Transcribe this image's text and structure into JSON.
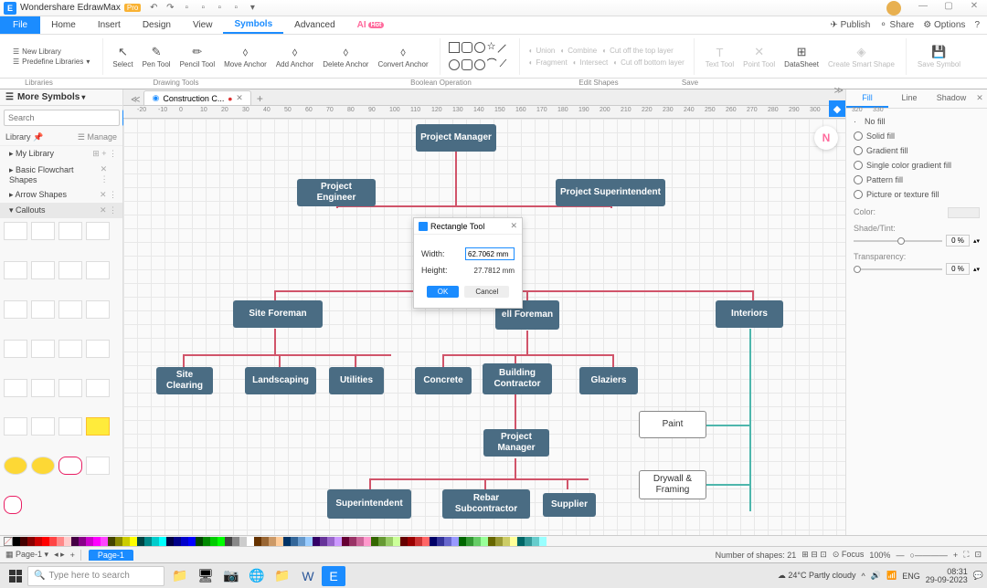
{
  "app": {
    "name": "Wondershare EdrawMax",
    "badge": "Pro"
  },
  "window_controls": {
    "min": "—",
    "max": "▢",
    "close": "✕"
  },
  "menu": {
    "file": "File",
    "home": "Home",
    "insert": "Insert",
    "design": "Design",
    "view": "View",
    "symbols": "Symbols",
    "advanced": "Advanced",
    "ai": "AI",
    "hot": "Hot",
    "publish": "✈ Publish",
    "share": "⚬ Share",
    "options": "⚙ Options"
  },
  "ribbon": {
    "new_library": "New Library",
    "predefine": "Predefine Libraries",
    "libraries": "Libraries",
    "select": "Select",
    "pen": "Pen Tool",
    "pencil": "Pencil Tool",
    "move_anchor": "Move Anchor",
    "add_anchor": "Add Anchor",
    "delete_anchor": "Delete Anchor",
    "convert_anchor": "Convert Anchor",
    "drawing": "Drawing Tools",
    "union": "Union",
    "combine": "Combine",
    "cut_top": "Cut off the top layer",
    "fragment": "Fragment",
    "intersect": "Intersect",
    "cut_bottom": "Cut off bottom layer",
    "boolean": "Boolean Operation",
    "text_tool": "Text Tool",
    "point_tool": "Point Tool",
    "datasheet": "DataSheet",
    "create_smart": "Create Smart Shape",
    "save_symbol": "Save Symbol",
    "edit": "Edit Shapes",
    "save": "Save"
  },
  "sidebar": {
    "more": "More Symbols",
    "search": "Search",
    "search_btn": "Search",
    "library": "Library",
    "manage": "Manage",
    "items": [
      "My Library",
      "Basic Flowchart Shapes",
      "Arrow Shapes",
      "Callouts"
    ]
  },
  "doc": {
    "tab": "Construction C...",
    "add": "+"
  },
  "ruler_marks": [
    -20,
    -10,
    0,
    10,
    20,
    30,
    40,
    50,
    60,
    70,
    80,
    90,
    100,
    110,
    120,
    130,
    140,
    150,
    160,
    170,
    180,
    190,
    200,
    210,
    220,
    230,
    240,
    250,
    260,
    270,
    280,
    290,
    300,
    310,
    320,
    330
  ],
  "nodes": {
    "pm": "Project Manager",
    "pe": "Project Engineer",
    "ps": "Project Superintendent",
    "sf": "Site Foreman",
    "shell": "ell Foreman",
    "interiors": "Interiors",
    "sc": "Site Clearing",
    "land": "Landscaping",
    "util": "Utilities",
    "conc": "Concrete",
    "bc": "Building Contractor",
    "glaz": "Glaziers",
    "pm2": "Project Manager",
    "super": "Superintendent",
    "rebar": "Rebar Subcontractor",
    "supplier": "Supplier",
    "paint": "Paint",
    "drywall": "Drywall & Framing"
  },
  "dialog": {
    "title": "Rectangle Tool",
    "width_label": "Width:",
    "width": "62.7062 mm",
    "height_label": "Height:",
    "height": "27.7812 mm",
    "ok": "OK",
    "cancel": "Cancel"
  },
  "right": {
    "fill": "Fill",
    "line": "Line",
    "shadow": "Shadow",
    "no_fill": "No fill",
    "solid": "Solid fill",
    "gradient": "Gradient fill",
    "single": "Single color gradient fill",
    "pattern": "Pattern fill",
    "picture": "Picture or texture fill",
    "color": "Color:",
    "shade": "Shade/Tint:",
    "transparency": "Transparency:",
    "zero": "0 %"
  },
  "status": {
    "page": "Page-1",
    "shapes": "Number of shapes: 21",
    "focus": "Focus",
    "zoom": "100%"
  },
  "taskbar": {
    "search": "Type here to search",
    "weather": "24°C  Partly cloudy",
    "time": "08:31",
    "date": "29-09-2023"
  }
}
